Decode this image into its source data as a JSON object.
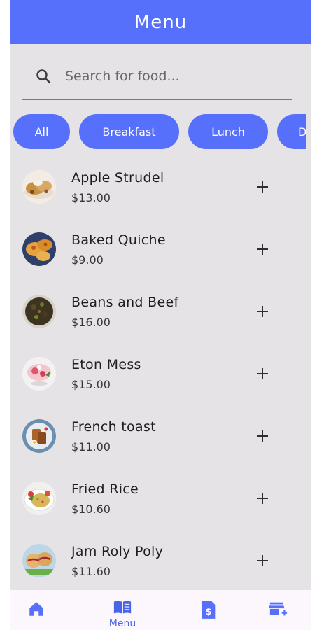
{
  "appbar": {
    "title": "Menu"
  },
  "search": {
    "placeholder": "Search for food..."
  },
  "categories": [
    "All",
    "Breakfast",
    "Lunch",
    "D"
  ],
  "items": [
    {
      "name": "Apple Strudel",
      "price": "$13.00"
    },
    {
      "name": "Baked Quiche",
      "price": "$9.00"
    },
    {
      "name": "Beans and Beef",
      "price": "$16.00"
    },
    {
      "name": "Eton Mess",
      "price": "$15.00"
    },
    {
      "name": "French toast",
      "price": "$11.00"
    },
    {
      "name": "Fried Rice",
      "price": "$10.60"
    },
    {
      "name": "Jam Roly Poly",
      "price": "$11.60"
    }
  ],
  "bottom_nav": {
    "active_label": "Menu",
    "icons": [
      "home-icon",
      "menu-book-icon",
      "receipt-dollar-icon",
      "store-add-icon"
    ]
  },
  "colors": {
    "primary": "#5670fc",
    "background": "#e6e3e7",
    "nav_background": "#fcf7fd"
  }
}
